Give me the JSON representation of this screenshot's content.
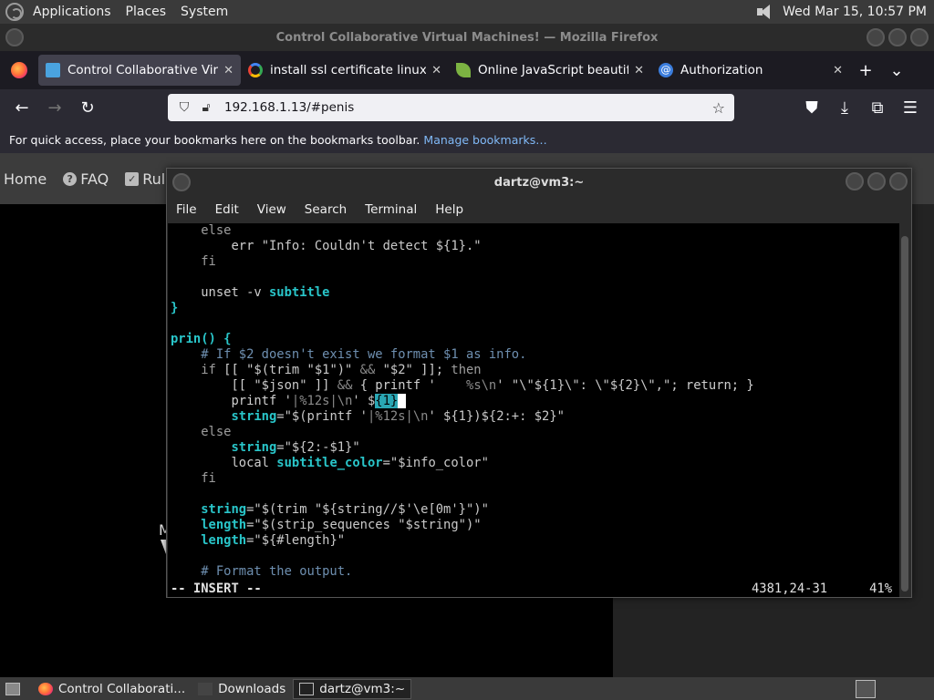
{
  "panel": {
    "menus": [
      "Applications",
      "Places",
      "System"
    ],
    "clock": "Wed Mar 15, 10:57 PM"
  },
  "firefox": {
    "window_title": "Control Collaborative Virtual Machines! — Mozilla Firefox",
    "tabs": [
      {
        "label": "Control Collaborative Virtua",
        "icon": "monitor-icon",
        "active": true
      },
      {
        "label": "install ssl certificate linux - G",
        "icon": "google-icon",
        "active": false
      },
      {
        "label": "Online JavaScript beautifier",
        "icon": "leaf-icon",
        "active": false
      },
      {
        "label": "Authorization",
        "icon": "at-icon",
        "active": false
      }
    ],
    "url": "192.168.1.13/#penis",
    "bookmarks_hint": "For quick access, place your bookmarks here on the bookmarks toolbar.",
    "manage_bookmarks": "Manage bookmarks…"
  },
  "site": {
    "nav": [
      {
        "label": "Home"
      },
      {
        "label": "FAQ"
      },
      {
        "label": "Rules"
      }
    ],
    "partial_letter": "M"
  },
  "terminal": {
    "title": "dartz@vm3:~",
    "menu": [
      "File",
      "Edit",
      "View",
      "Search",
      "Terminal",
      "Help"
    ],
    "status": {
      "mode": "-- INSERT --",
      "position": "4381,24-31",
      "percent": "41%"
    }
  },
  "taskbar": {
    "tasks": [
      {
        "label": "Control Collaborati...",
        "icon": "firefox-icon"
      },
      {
        "label": "Downloads",
        "icon": "folder-icon"
      },
      {
        "label": "dartz@vm3:~",
        "icon": "terminal-icon"
      }
    ]
  }
}
